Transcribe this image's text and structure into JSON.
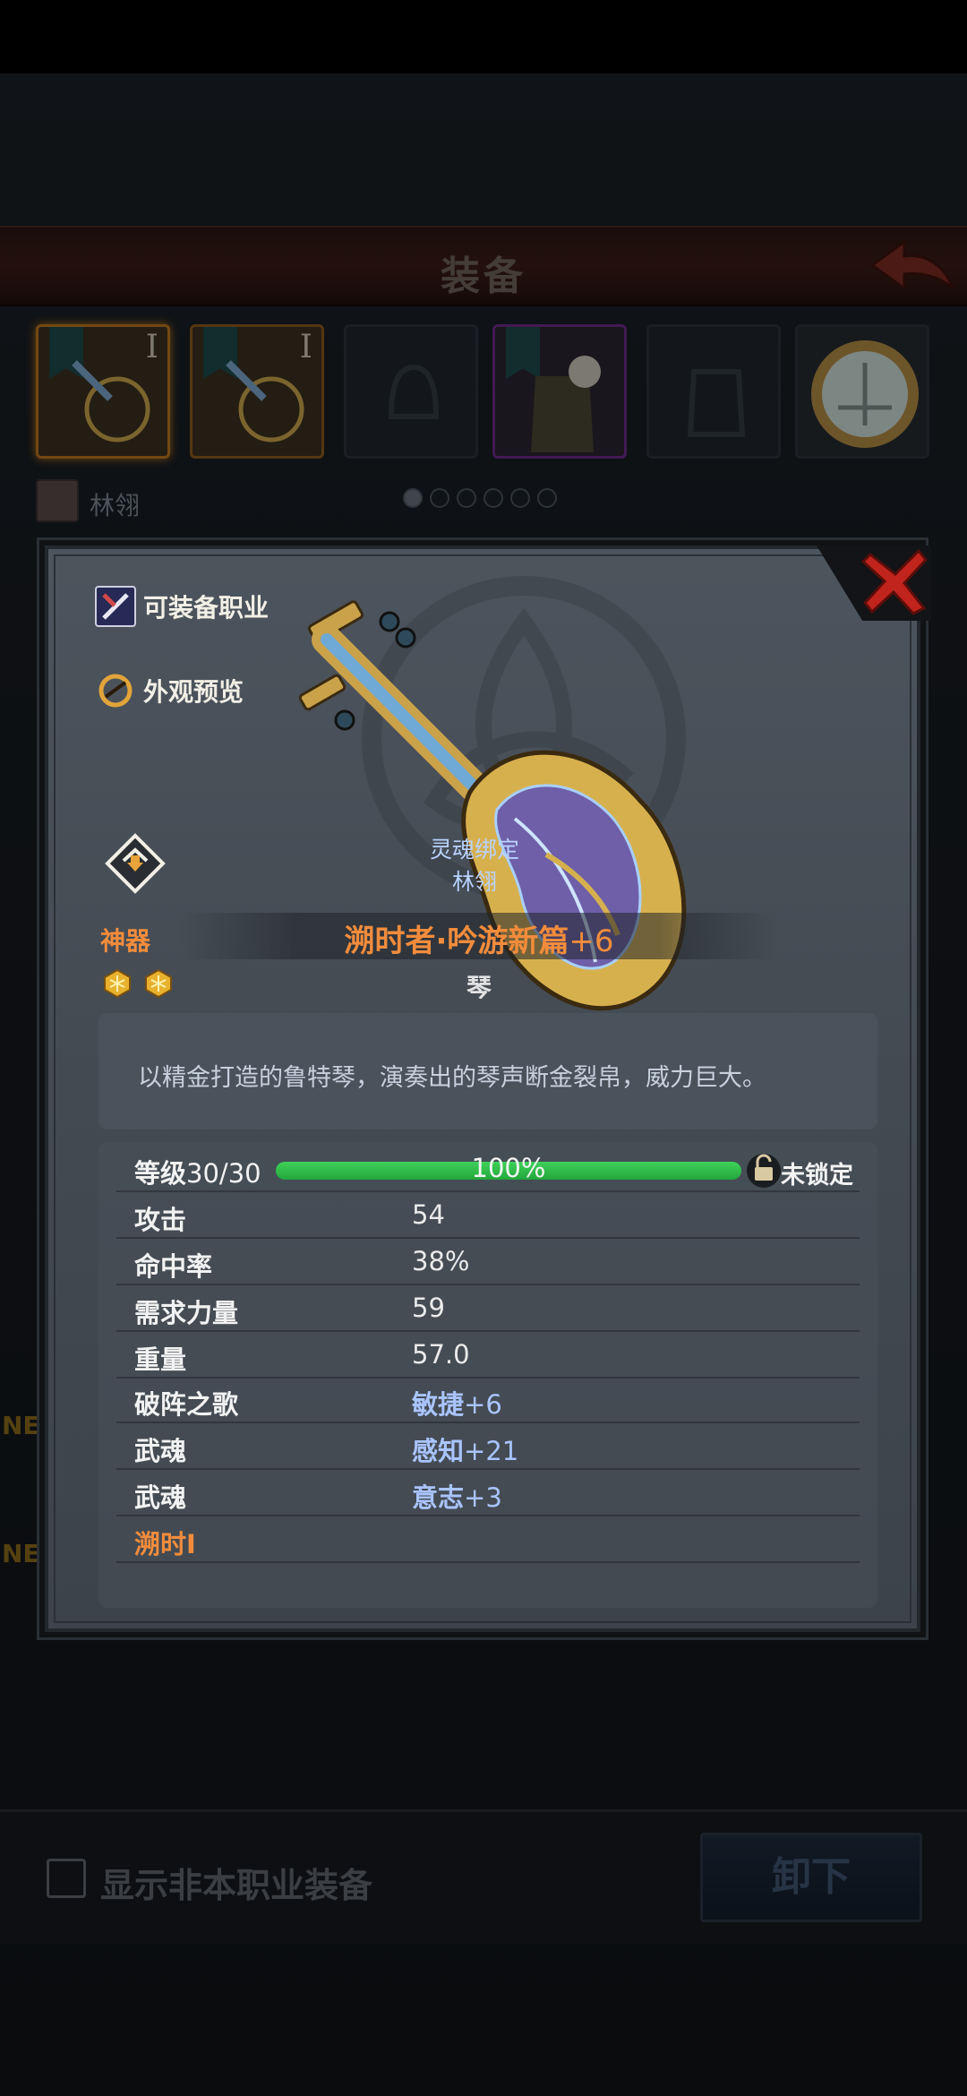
{
  "header": {
    "title": "装备"
  },
  "equipment_slots": [
    {
      "tier": "I",
      "quality": "gold",
      "selected": true
    },
    {
      "tier": "I",
      "quality": "gold",
      "selected": false
    },
    {
      "tier": "",
      "quality": "empty",
      "selected": false
    },
    {
      "tier": "",
      "quality": "purple",
      "selected": false
    },
    {
      "tier": "",
      "quality": "empty",
      "selected": false
    },
    {
      "tier": "",
      "quality": "round",
      "selected": false
    }
  ],
  "hero": {
    "name": "林翎"
  },
  "page_dots": {
    "count": 6,
    "active": 0
  },
  "side_labels": {
    "left_ne_1": "NE",
    "left_ne_2": "NE"
  },
  "bottom": {
    "checkbox_label": "显示非本职业装备",
    "unequip_label": "卸下"
  },
  "modal": {
    "buttons": {
      "class_label": "可装备职业",
      "preview_label": "外观预览"
    },
    "soul_bind": {
      "label": "灵魂绑定",
      "owner": "林翎"
    },
    "rarity": "神器",
    "stars": 2,
    "item_name": "溯时者·吟游新篇",
    "enhance": "+6",
    "item_type": "琴",
    "description": "以精金打造的鲁特琴，演奏出的琴声断金裂帛，威力巨大。",
    "level": {
      "label": "等级",
      "value": "30/30",
      "progress_text": "100%",
      "progress": 1.0,
      "lock_label": "未锁定"
    },
    "stats": [
      {
        "key": "攻击",
        "value": "54"
      },
      {
        "key": "命中率",
        "value": "38%"
      },
      {
        "key": "需求力量",
        "value": "59"
      },
      {
        "key": "重量",
        "value": "57.0"
      }
    ],
    "bonus_stats": [
      {
        "key": "破阵之歌",
        "attr": "敏捷",
        "value": "+6"
      },
      {
        "key": "武魂",
        "attr": "感知",
        "value": "+21"
      },
      {
        "key": "武魂",
        "attr": "意志",
        "value": "+3"
      }
    ],
    "set_label": "溯时I"
  },
  "colors": {
    "rarity_orange": "#f28c3c",
    "bonus_blue": "#a9c4ff",
    "xp_green": "#2fbf4a",
    "close_red": "#c0241c"
  }
}
